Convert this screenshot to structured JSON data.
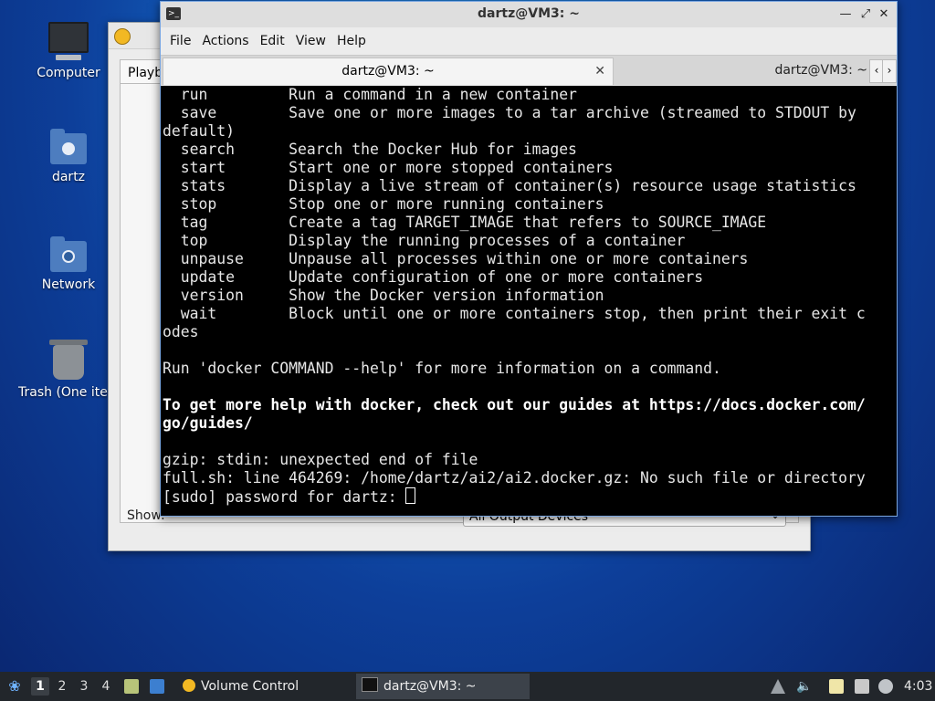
{
  "desktop": {
    "icons": [
      {
        "label": "Computer"
      },
      {
        "label": "dartz"
      },
      {
        "label": "Network"
      },
      {
        "label": "Trash (One item)"
      }
    ]
  },
  "volume_window": {
    "tab_label": "Playback",
    "show_label": "Show:",
    "device_select": "All Output Devices"
  },
  "terminal": {
    "title": "dartz@VM3: ~",
    "menu": [
      "File",
      "Actions",
      "Edit",
      "View",
      "Help"
    ],
    "tabs": [
      {
        "label": "dartz@VM3: ~",
        "active": true
      },
      {
        "label": "dartz@VM3: ~",
        "active": false
      }
    ],
    "lines": [
      "  run         Run a command in a new container",
      "  save        Save one or more images to a tar archive (streamed to STDOUT by",
      "default)",
      "  search      Search the Docker Hub for images",
      "  start       Start one or more stopped containers",
      "  stats       Display a live stream of container(s) resource usage statistics",
      "  stop        Stop one or more running containers",
      "  tag         Create a tag TARGET_IMAGE that refers to SOURCE_IMAGE",
      "  top         Display the running processes of a container",
      "  unpause     Unpause all processes within one or more containers",
      "  update      Update configuration of one or more containers",
      "  version     Show the Docker version information",
      "  wait        Block until one or more containers stop, then print their exit c",
      "odes",
      "",
      "Run 'docker COMMAND --help' for more information on a command.",
      ""
    ],
    "bold_lines": [
      "To get more help with docker, check out our guides at https://docs.docker.com/",
      "go/guides/"
    ],
    "tail_lines": [
      "",
      "gzip: stdin: unexpected end of file",
      "full.sh: line 464269: /home/dartz/ai2/ai2.docker.gz: No such file or directory"
    ],
    "prompt": "[sudo] password for dartz: "
  },
  "taskbar": {
    "workspaces": [
      "1",
      "2",
      "3",
      "4"
    ],
    "active_workspace": "1",
    "tasks": [
      {
        "label": "Volume Control"
      },
      {
        "label": "dartz@VM3: ~"
      }
    ],
    "clock": "4:03"
  },
  "colors": {
    "terminal_bg": "#000000",
    "taskbar_bg": "#22262b",
    "accent": "#7aa6e0"
  }
}
